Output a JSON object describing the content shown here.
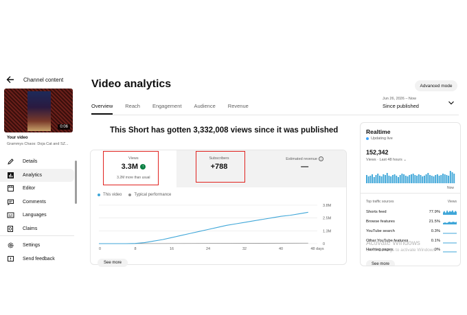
{
  "sidebar": {
    "title": "Channel content",
    "thumbnail_duration": "0:06",
    "your_video_label": "Your video",
    "video_title": "Grammys Chaos: Doja Cat and SZ...",
    "items": [
      {
        "label": "Details",
        "icon": "pencil-icon"
      },
      {
        "label": "Analytics",
        "icon": "bar-chart-icon",
        "active": true
      },
      {
        "label": "Editor",
        "icon": "film-editor-icon"
      },
      {
        "label": "Comments",
        "icon": "comment-icon"
      },
      {
        "label": "Languages",
        "icon": "subtitles-icon"
      },
      {
        "label": "Claims",
        "icon": "copyright-claim-icon"
      }
    ],
    "bottom_items": [
      {
        "label": "Settings",
        "icon": "gear-icon"
      },
      {
        "label": "Send feedback",
        "icon": "feedback-icon"
      }
    ]
  },
  "header": {
    "title": "Video analytics",
    "advanced_mode": "Advanced mode",
    "tabs": [
      "Overview",
      "Reach",
      "Engagement",
      "Audience",
      "Revenue"
    ],
    "active_tab": "Overview",
    "date_range": {
      "sub": "Jun 26, 2026 – Now",
      "main": "Since published"
    }
  },
  "headline": "This Short has gotten 3,332,008 views since it was published",
  "metrics": {
    "views": {
      "label": "Views",
      "value": "3.3M",
      "sub": "3.2M more than usual"
    },
    "subscribers": {
      "label": "Subscribers",
      "value": "+788"
    },
    "revenue": {
      "label": "Estimated revenue",
      "value": "—"
    }
  },
  "chart_data": {
    "type": "line",
    "series": [
      {
        "name": "This video",
        "x": [
          0,
          2,
          4,
          6,
          8,
          10,
          12,
          14,
          16,
          18,
          20,
          22,
          24,
          26,
          28,
          30,
          32,
          34,
          36,
          38,
          40,
          42,
          44,
          46
        ],
        "y": [
          0,
          0,
          0,
          0,
          0.02,
          0.1,
          0.25,
          0.4,
          0.6,
          0.8,
          1.0,
          1.2,
          1.4,
          1.6,
          1.8,
          1.95,
          2.1,
          2.25,
          2.4,
          2.55,
          2.7,
          2.8,
          2.95,
          3.1
        ]
      },
      {
        "name": "Typical performance",
        "x": [
          0,
          46
        ],
        "y": [
          0,
          0.05
        ]
      }
    ],
    "x_ticks": [
      "0",
      "8",
      "16",
      "24",
      "32",
      "40",
      "48 days"
    ],
    "y_ticks": [
      "3.8M",
      "2.5M",
      "1.3M",
      "0"
    ],
    "xlim": [
      0,
      48
    ],
    "ylim": [
      0,
      3.8
    ],
    "colors": {
      "this_video": "#3ea6d8",
      "typical": "#909090"
    }
  },
  "see_more": "See more",
  "realtime": {
    "title": "Realtime",
    "live": "Updating live",
    "count": "152,342",
    "sub": "Views · Last 48 hours",
    "now_label": "Now",
    "bars": [
      12,
      10,
      11,
      13,
      9,
      12,
      14,
      11,
      10,
      13,
      12,
      15,
      11,
      10,
      12,
      13,
      11,
      9,
      12,
      14,
      13,
      11,
      10,
      12,
      13,
      14,
      12,
      11,
      13,
      12,
      10,
      11,
      13,
      15,
      12,
      11,
      10,
      12,
      13,
      11,
      12,
      14,
      13,
      12,
      11,
      18,
      16,
      14
    ],
    "sources_header": "Top traffic sources",
    "sources_value_header": "Views",
    "sources": [
      {
        "name": "Shorts feed",
        "value": "77.9%"
      },
      {
        "name": "Browse features",
        "value": "21.5%"
      },
      {
        "name": "YouTube search",
        "value": "0.3%"
      },
      {
        "name": "Other YouTube features",
        "value": "0.1%"
      },
      {
        "name": "Hashtag pages",
        "value": "0%"
      }
    ]
  },
  "watermark": {
    "line1": "Activate Windows",
    "line2": "Go to Settings to activate Windows."
  },
  "colors": {
    "accent_red": "#e0201c",
    "live_blue": "#3ea6ff",
    "green_badge": "#0b8043"
  }
}
